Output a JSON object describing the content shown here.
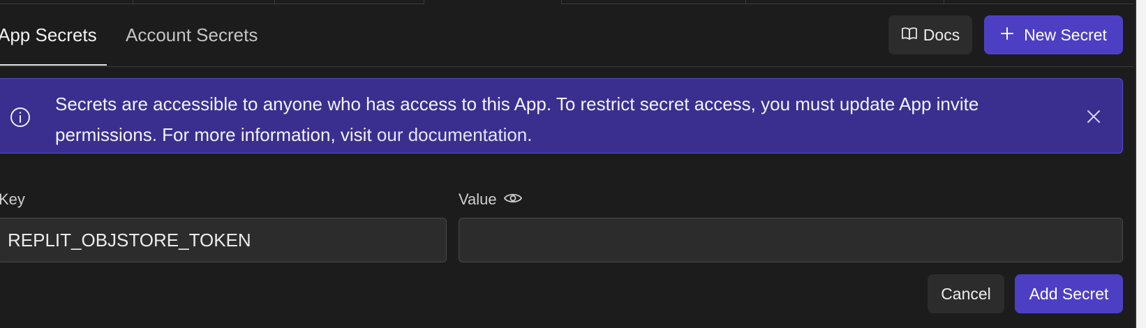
{
  "tabs": {
    "active_label": "App Secrets",
    "inactive_label": "Account Secrets"
  },
  "header_actions": {
    "docs_label": "Docs",
    "docs_icon": "book-open-icon",
    "new_secret_label": "New Secret",
    "new_secret_icon": "plus-icon"
  },
  "banner": {
    "icon": "info-icon",
    "message_prefix": "Secrets are accessible to anyone who has access to this App. To restrict secret access, you must update App invite permissions. For more information, visit ",
    "link_text": "our documentation",
    "message_suffix": ".",
    "close_icon": "close-icon"
  },
  "form": {
    "key_label": "Key",
    "key_value": "REPLIT_OBJSTORE_TOKEN",
    "value_label": "Value",
    "value_icon": "eye-icon",
    "value_value": "",
    "cancel_label": "Cancel",
    "submit_label": "Add Secret"
  },
  "colors": {
    "background": "#1c1c1c",
    "accent": "#4d3fc4",
    "banner_bg": "#3a2f8e",
    "banner_border": "#5a4bd8",
    "surface": "#2c2c2c"
  }
}
